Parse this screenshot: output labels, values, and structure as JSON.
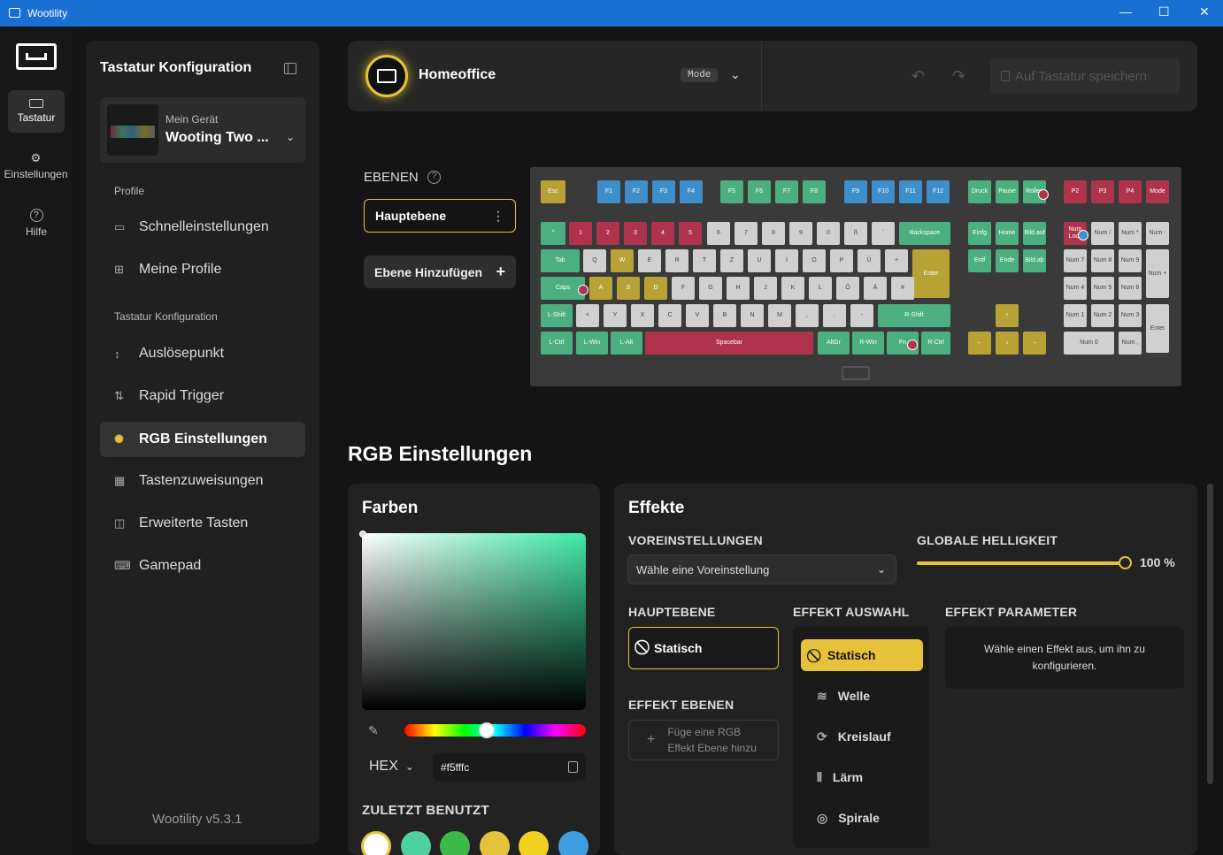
{
  "window": {
    "title": "Wootility",
    "minimize": "—",
    "maximize": "☐",
    "close": "✕"
  },
  "rail": {
    "items": [
      {
        "label": "Tastatur",
        "icon": "keyboard-icon"
      },
      {
        "label": "Einstellungen",
        "icon": "gear-icon"
      },
      {
        "label": "Hilfe",
        "icon": "help-icon"
      }
    ]
  },
  "sidebar": {
    "title": "Tastatur Konfiguration",
    "device_caption": "Mein Gerät",
    "device_name": "Wooting Two ...",
    "section_profiles": "Profile",
    "quick_settings": "Schnelleinstellungen",
    "my_profiles": "Meine Profile",
    "section_config": "Tastatur Konfiguration",
    "items": [
      "Auslösepunkt",
      "Rapid Trigger",
      "RGB Einstellungen",
      "Tastenzuweisungen",
      "Erweiterte Tasten",
      "Gamepad"
    ],
    "version": "Wootility v5.3.1"
  },
  "header": {
    "profile_name": "Homeoffice",
    "mode_label": "Mode",
    "save_label": "Auf Tastatur speichern"
  },
  "layers": {
    "title": "EBENEN",
    "main_layer": "Hauptebene",
    "add_layer": "Ebene Hinzufügen"
  },
  "keyboard": {
    "colors": {
      "yellow": "#b8a135",
      "blue": "#3e8fc9",
      "green": "#4caf82",
      "red": "#b0334e",
      "gray": "#d0d0d0"
    },
    "keys": [
      [
        "Esc",
        "yellow"
      ],
      [
        "F1",
        "blue"
      ],
      [
        "F2",
        "blue"
      ],
      [
        "F3",
        "blue"
      ],
      [
        "F4",
        "blue"
      ],
      [
        "F5",
        "green"
      ],
      [
        "F6",
        "green"
      ],
      [
        "F7",
        "green"
      ],
      [
        "F8",
        "green"
      ],
      [
        "F9",
        "blue"
      ],
      [
        "F10",
        "blue"
      ],
      [
        "F11",
        "blue"
      ],
      [
        "F12",
        "blue"
      ],
      [
        "Druck",
        "green"
      ],
      [
        "Pause",
        "green"
      ],
      [
        "Rollen",
        "green"
      ],
      [
        "P2",
        "red"
      ],
      [
        "P3",
        "red"
      ],
      [
        "P4",
        "red"
      ],
      [
        "Mode",
        "red"
      ],
      [
        "^",
        "green"
      ],
      [
        "1",
        "red"
      ],
      [
        "2",
        "red"
      ],
      [
        "3",
        "red"
      ],
      [
        "4",
        "red"
      ],
      [
        "5",
        "red"
      ],
      [
        "6",
        "gray"
      ],
      [
        "7",
        "gray"
      ],
      [
        "8",
        "gray"
      ],
      [
        "9",
        "gray"
      ],
      [
        "0",
        "gray"
      ],
      [
        "ß",
        "gray"
      ],
      [
        "´",
        "gray"
      ],
      [
        "Backspace",
        "green"
      ],
      [
        "Einfg",
        "green"
      ],
      [
        "Home",
        "green"
      ],
      [
        "Bild auf",
        "green"
      ],
      [
        "Num Lock",
        "red"
      ],
      [
        "Num /",
        "gray"
      ],
      [
        "Num *",
        "gray"
      ],
      [
        "Num -",
        "gray"
      ],
      [
        "Tab",
        "green"
      ],
      [
        "Q",
        "gray"
      ],
      [
        "W",
        "yellow"
      ],
      [
        "E",
        "gray"
      ],
      [
        "R",
        "gray"
      ],
      [
        "T",
        "gray"
      ],
      [
        "Z",
        "gray"
      ],
      [
        "U",
        "gray"
      ],
      [
        "I",
        "gray"
      ],
      [
        "O",
        "gray"
      ],
      [
        "P",
        "gray"
      ],
      [
        "Ü",
        "gray"
      ],
      [
        "+",
        "gray"
      ],
      [
        "Enter",
        "yellow"
      ],
      [
        "Entf",
        "green"
      ],
      [
        "Ende",
        "green"
      ],
      [
        "Bild ab",
        "green"
      ],
      [
        "Num 7",
        "gray"
      ],
      [
        "Num 8",
        "gray"
      ],
      [
        "Num 9",
        "gray"
      ],
      [
        "Num +",
        "gray"
      ],
      [
        "Caps",
        "green"
      ],
      [
        "A",
        "yellow"
      ],
      [
        "S",
        "yellow"
      ],
      [
        "D",
        "yellow"
      ],
      [
        "F",
        "gray"
      ],
      [
        "G",
        "gray"
      ],
      [
        "H",
        "gray"
      ],
      [
        "J",
        "gray"
      ],
      [
        "K",
        "gray"
      ],
      [
        "L",
        "gray"
      ],
      [
        "Ö",
        "gray"
      ],
      [
        "Ä",
        "gray"
      ],
      [
        "#",
        "gray"
      ],
      [
        "Num 4",
        "gray"
      ],
      [
        "Num 5",
        "gray"
      ],
      [
        "Num 6",
        "gray"
      ],
      [
        "L-Shift",
        "green"
      ],
      [
        "<",
        "gray"
      ],
      [
        "Y",
        "gray"
      ],
      [
        "X",
        "gray"
      ],
      [
        "C",
        "gray"
      ],
      [
        "V",
        "gray"
      ],
      [
        "B",
        "gray"
      ],
      [
        "N",
        "gray"
      ],
      [
        "M",
        "gray"
      ],
      [
        ",",
        "gray"
      ],
      [
        ".",
        "gray"
      ],
      [
        "-",
        "gray"
      ],
      [
        "R-Shift",
        "green"
      ],
      [
        "↑",
        "yellow"
      ],
      [
        "Num 1",
        "gray"
      ],
      [
        "Num 2",
        "gray"
      ],
      [
        "Num 3",
        "gray"
      ],
      [
        "Enter",
        "gray"
      ],
      [
        "L-Ctrl",
        "green"
      ],
      [
        "L-Win",
        "green"
      ],
      [
        "L-Alt",
        "green"
      ],
      [
        "Spacebar",
        "red"
      ],
      [
        "AltGr",
        "green"
      ],
      [
        "R-Win",
        "green"
      ],
      [
        "Fn",
        "green"
      ],
      [
        "R-Ctrl",
        "green"
      ],
      [
        "←",
        "yellow"
      ],
      [
        "↓",
        "yellow"
      ],
      [
        "→",
        "yellow"
      ],
      [
        "Num 0",
        "gray"
      ],
      [
        "Num ,",
        "gray"
      ]
    ]
  },
  "rgb": {
    "title": "RGB Einstellungen",
    "colors_title": "Farben",
    "hex_label": "HEX",
    "hex_value": "#f5fffc",
    "recent_title": "ZULETZT BENUTZT",
    "recent_colors": [
      "#ffffff",
      "#4fd0a0",
      "#3db84a",
      "#e6c23a",
      "#f0d020",
      "#3e9fe0"
    ],
    "effects_title": "Effekte",
    "presets_label": "VOREINSTELLUNGEN",
    "presets_placeholder": "Wähle eine Voreinstellung",
    "brightness_label": "GLOBALE HELLIGKEIT",
    "brightness_value": "100 %",
    "brightness": 1.0,
    "main_layer_label": "HAUPTEBENE",
    "main_layer_effect": "Statisch",
    "effect_layers_label": "EFFEKT EBENEN",
    "add_effect_layer": "Füge eine RGB Effekt Ebene hinzu",
    "effect_select_label": "EFFEKT AUSWAHL",
    "effects": [
      "Statisch",
      "Welle",
      "Kreislauf",
      "Lärm",
      "Spirale"
    ],
    "params_label": "EFFEKT PARAMETER",
    "params_hint": "Wähle einen Effekt aus, um ihn zu konfigurieren."
  }
}
